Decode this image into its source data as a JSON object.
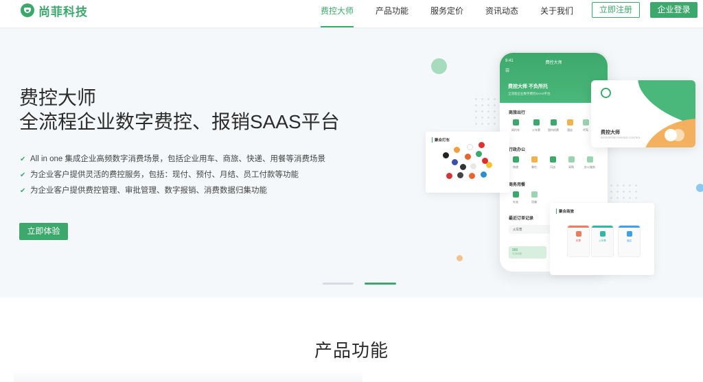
{
  "brand": {
    "name": "尚菲科技",
    "color": "#3da86b"
  },
  "nav": {
    "items": [
      {
        "label": "费控大师",
        "active": true
      },
      {
        "label": "产品功能",
        "active": false
      },
      {
        "label": "服务定价",
        "active": false
      },
      {
        "label": "资讯动态",
        "active": false
      },
      {
        "label": "关于我们",
        "active": false
      }
    ],
    "register_label": "立即注册",
    "login_label": "企业登录"
  },
  "hero": {
    "title": "费控大师",
    "subtitle": "全流程企业数字费控、报销SAAS平台",
    "features": [
      "All in one 集成企业高频数字消费场景，包括企业用车、商旅、快递、用餐等消费场景",
      "为企业客户提供灵活的费控服务，包括：现付、预付、月结、员工付款等功能",
      "为企业客户提供费控管理、审批管理、数字报销、消费数据归集功能"
    ],
    "cta_label": "立即体验",
    "carousel": {
      "slides": 2,
      "active_index": 1
    }
  },
  "phone": {
    "time": "9:41",
    "header_title": "费控大师",
    "slogan": "费控大师 不负所托",
    "desc": "全流程企业数字费控SAAS平台",
    "sections": [
      {
        "title": "商旅出行",
        "items": [
          "网约车",
          "火车票",
          "国内机票",
          "酒店",
          "代驾"
        ]
      },
      {
        "title": "行政办公",
        "items": [
          "快递",
          "餐饮",
          "闪送",
          "采购",
          "办公服务"
        ]
      },
      {
        "title": "商务用餐",
        "items": [
          "外卖",
          "用餐"
        ]
      }
    ],
    "orders_title": "最近订单记录",
    "order_item": "火车票",
    "bottom_value": "900",
    "bottom_label": "可用余额"
  },
  "card_left": {
    "title": "聚合打车"
  },
  "card_right": {
    "name": "费控大师",
    "sub": "ENTERPRISE EXPENSE CONTROL"
  },
  "card_bottom": {
    "title": "聚合商旅",
    "minis": [
      "机票",
      "火车票",
      "酒店"
    ]
  },
  "section": {
    "title": "产品功能"
  }
}
